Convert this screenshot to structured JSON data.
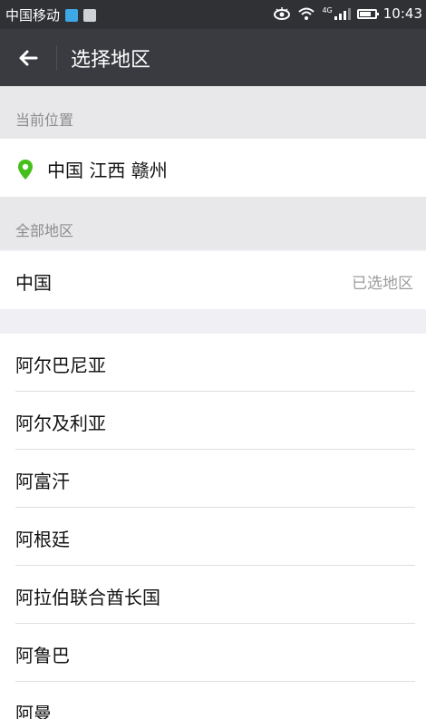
{
  "status_bar": {
    "carrier": "中国移动",
    "network": "4G",
    "time": "10:43"
  },
  "header": {
    "title": "选择地区"
  },
  "current_location": {
    "section_title": "当前位置",
    "location": "中国 江西 赣州"
  },
  "all_regions": {
    "section_title": "全部地区",
    "selected_country": "中国",
    "selected_hint": "已选地区"
  },
  "regions": [
    {
      "label": "阿尔巴尼亚"
    },
    {
      "label": "阿尔及利亚"
    },
    {
      "label": "阿富汗"
    },
    {
      "label": "阿根廷"
    },
    {
      "label": "阿拉伯联合酋长国"
    },
    {
      "label": "阿鲁巴"
    },
    {
      "label": "阿曼"
    }
  ],
  "colors": {
    "accent_green": "#45c01a",
    "header_bg": "#3a3b40",
    "statusbar_bg": "#2f3135"
  }
}
